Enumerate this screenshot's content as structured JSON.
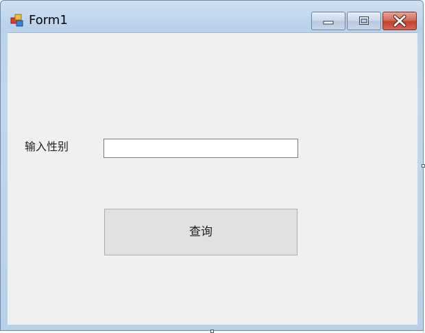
{
  "window": {
    "title": "Form1",
    "controls": {
      "minimize_icon": "minimize-icon",
      "maximize_icon": "maximize-icon",
      "close_icon": "close-icon"
    }
  },
  "form": {
    "label": "输入性别",
    "input_value": "",
    "query_button_label": "查询"
  },
  "colors": {
    "client_background": "#f0f0f0",
    "button_background": "#e1e1e1",
    "close_button": "#c2402c",
    "frame": "#b9d1ea"
  }
}
